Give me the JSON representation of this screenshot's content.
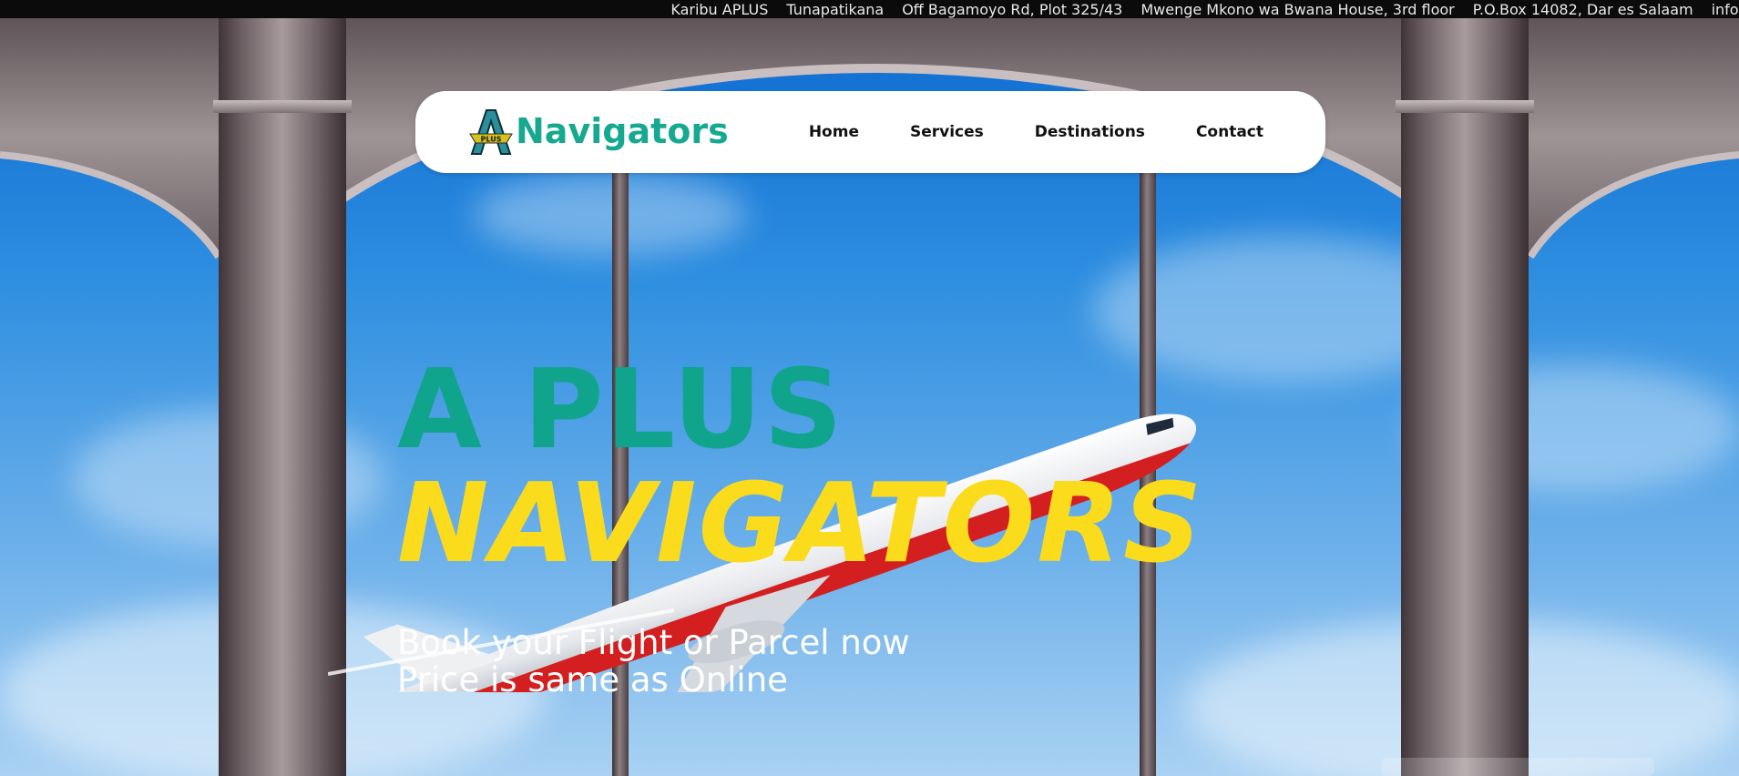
{
  "topbar": {
    "items": [
      "Karibu APLUS",
      "Tunapatikana",
      "Off Bagamoyo Rd, Plot 325/43",
      "Mwenge Mkono wa Bwana House, 3rd floor",
      "P.O.Box 14082, Dar es Salaam",
      "info@apl"
    ]
  },
  "nav": {
    "logo_text": "Navigators",
    "logo_badge": "PLUS",
    "logo_icon": "a-plus-logo-icon",
    "menu": [
      "Home",
      "Services",
      "Destinations",
      "Contact"
    ]
  },
  "hero": {
    "line1": "A PLUS",
    "line2": "NAVIGATORS",
    "sub1": "Book your Flight or Parcel now",
    "sub2": "Price is same as Online"
  },
  "colors": {
    "brand_green": "#16a98f",
    "brand_yellow": "#fbdc1d",
    "sky": "#1f7fd6",
    "topbar": "#0b0b0b"
  }
}
